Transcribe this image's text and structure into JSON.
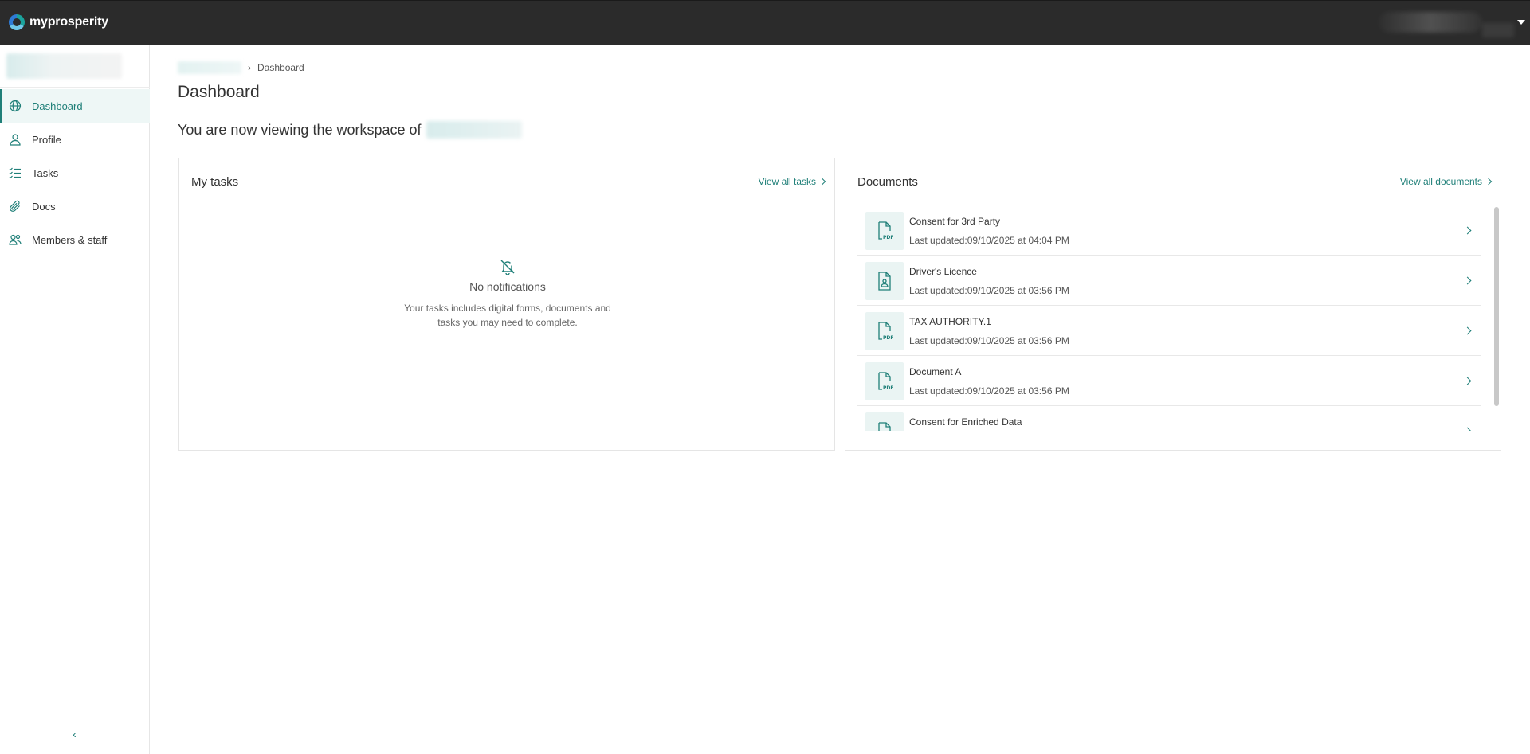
{
  "app": {
    "brand": "myprosperity"
  },
  "sidebar": {
    "items": [
      {
        "label": "Dashboard",
        "icon": "globe-icon",
        "active": true
      },
      {
        "label": "Profile",
        "icon": "user-icon",
        "active": false
      },
      {
        "label": "Tasks",
        "icon": "checklist-icon",
        "active": false
      },
      {
        "label": "Docs",
        "icon": "paperclip-icon",
        "active": false
      },
      {
        "label": "Members & staff",
        "icon": "users-icon",
        "active": false
      }
    ],
    "collapse_glyph": "‹"
  },
  "breadcrumb": {
    "current": "Dashboard",
    "separator": "›"
  },
  "page": {
    "title": "Dashboard",
    "workspace_prefix": "You are now viewing the workspace of"
  },
  "tasks_card": {
    "title": "My tasks",
    "view_all": "View all tasks",
    "empty_title": "No notifications",
    "empty_desc": "Your tasks includes digital forms, documents and tasks you may need to complete."
  },
  "docs_card": {
    "title": "Documents",
    "view_all": "View all documents",
    "items": [
      {
        "name": "Consent for 3rd Party",
        "updated": "Last updated:09/10/2025 at 04:04 PM",
        "icon": "pdf-file-icon"
      },
      {
        "name": "Driver's Licence",
        "updated": "Last updated:09/10/2025 at 03:56 PM",
        "icon": "image-file-icon"
      },
      {
        "name": "TAX AUTHORITY.1",
        "updated": "Last updated:09/10/2025 at 03:56 PM",
        "icon": "pdf-file-icon"
      },
      {
        "name": "Document A",
        "updated": "Last updated:09/10/2025 at 03:56 PM",
        "icon": "pdf-file-icon"
      },
      {
        "name": "Consent for Enriched Data",
        "updated": "",
        "icon": "pdf-file-icon"
      }
    ]
  },
  "colors": {
    "accent": "#1f7f78",
    "topbar": "#2b2b2b",
    "active_bg": "#eef7f6",
    "icon_bg": "#eaf4f3"
  }
}
